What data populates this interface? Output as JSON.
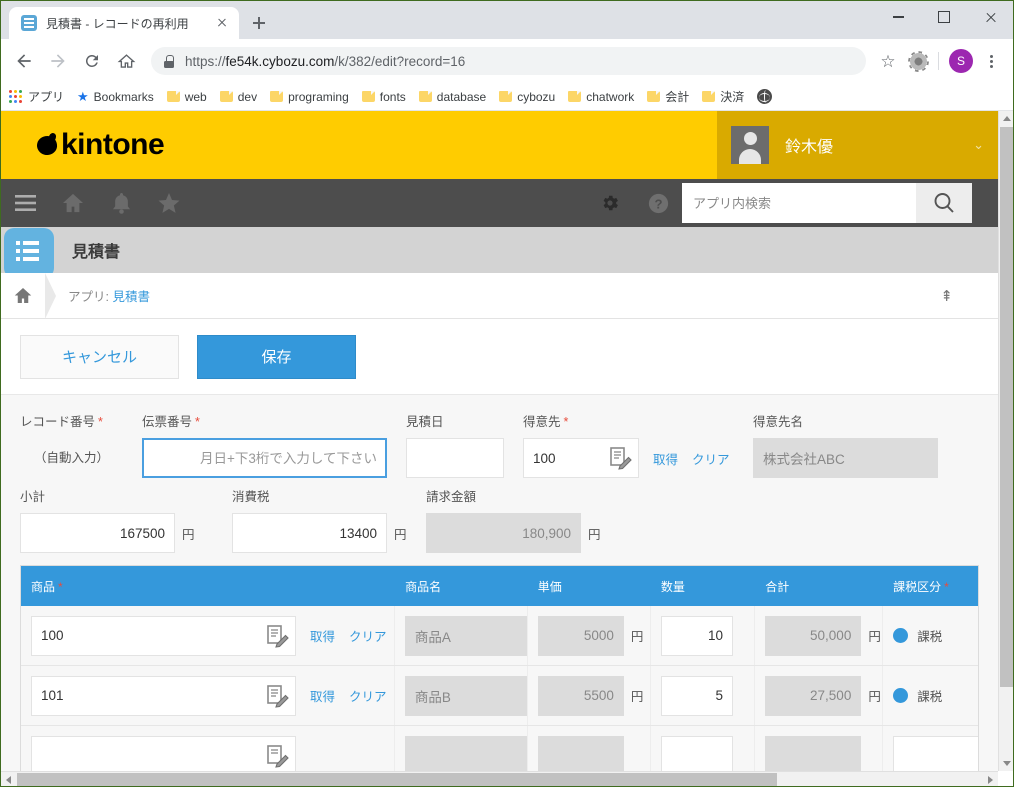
{
  "browser": {
    "tab": {
      "title": "見積書 - レコードの再利用",
      "favicon": "kintone-app-icon"
    },
    "new_tab_label": "+",
    "url_prefix": "https://",
    "url_domain": "fe54k.cybozu.com",
    "url_path": "/k/382/edit?record=16",
    "url_full": "https://fe54k.cybozu.com/k/382/edit?record=16",
    "profile_initial": "S",
    "bookmarks": [
      {
        "label": "アプリ",
        "icon": "apps-grid-icon"
      },
      {
        "label": "Bookmarks",
        "icon": "star-icon"
      },
      {
        "label": "web",
        "icon": "folder-icon"
      },
      {
        "label": "dev",
        "icon": "folder-icon"
      },
      {
        "label": "programing",
        "icon": "folder-icon"
      },
      {
        "label": "fonts",
        "icon": "folder-icon"
      },
      {
        "label": "database",
        "icon": "folder-icon"
      },
      {
        "label": "cybozu",
        "icon": "folder-icon"
      },
      {
        "label": "chatwork",
        "icon": "folder-icon"
      },
      {
        "label": "会計",
        "icon": "folder-icon"
      },
      {
        "label": "決済",
        "icon": "folder-icon"
      },
      {
        "label": "",
        "icon": "globe-icon"
      }
    ]
  },
  "kintone": {
    "logo_text": "kintone",
    "user_name": "鈴木優",
    "nav_icons": [
      "menu-icon",
      "home-icon",
      "bell-icon",
      "star-icon",
      "gear-icon",
      "help-icon"
    ],
    "search": {
      "placeholder": "アプリ内検索",
      "value": ""
    },
    "app_name": "見積書",
    "breadcrumb_prefix": "アプリ:",
    "breadcrumb_link": "見積書"
  },
  "actions": {
    "cancel_label": "キャンセル",
    "save_label": "保存"
  },
  "form": {
    "record_number": {
      "label": "レコード番号",
      "required": true,
      "value": "（自動入力）"
    },
    "slip_number": {
      "label": "伝票番号",
      "required": true,
      "value": "",
      "placeholder": "月日+下3桁で入力して下さい",
      "focused": true
    },
    "quote_date": {
      "label": "見積日",
      "required": false,
      "value": ""
    },
    "customer": {
      "label": "得意先",
      "required": true,
      "value": "100",
      "lookup_icon": "lookup-icon",
      "get_label": "取得",
      "clear_label": "クリア"
    },
    "customer_name": {
      "label": "得意先名",
      "required": false,
      "value": "株式会社ABC",
      "disabled": true
    },
    "subtotal": {
      "label": "小計",
      "value": "167500",
      "unit": "円"
    },
    "tax": {
      "label": "消費税",
      "value": "13400",
      "unit": "円"
    },
    "billing_amount": {
      "label": "請求金額",
      "value": "180,900",
      "unit": "円",
      "disabled": true
    }
  },
  "table": {
    "columns": [
      {
        "key": "product",
        "label": "商品",
        "required": true
      },
      {
        "key": "product_name",
        "label": "商品名",
        "required": false
      },
      {
        "key": "unit_price",
        "label": "単価",
        "required": false
      },
      {
        "key": "quantity",
        "label": "数量",
        "required": false
      },
      {
        "key": "total",
        "label": "合計",
        "required": false
      },
      {
        "key": "tax_type",
        "label": "課税区分",
        "required": true
      }
    ],
    "get_label": "取得",
    "clear_label": "クリア",
    "unit": "円",
    "rows": [
      {
        "product": "100",
        "product_name": "商品A",
        "unit_price": "5000",
        "quantity": "10",
        "total": "50,000",
        "tax_type": "課税"
      },
      {
        "product": "101",
        "product_name": "商品B",
        "unit_price": "5500",
        "quantity": "5",
        "total": "27,500",
        "tax_type": "課税"
      }
    ]
  },
  "colors": {
    "kintone_yellow": "#ffcc00",
    "kintone_yellow_dark": "#d9aa00",
    "nav_dark": "#4d4d4d",
    "accent_blue": "#3498db",
    "required_red": "#e74c3c"
  }
}
